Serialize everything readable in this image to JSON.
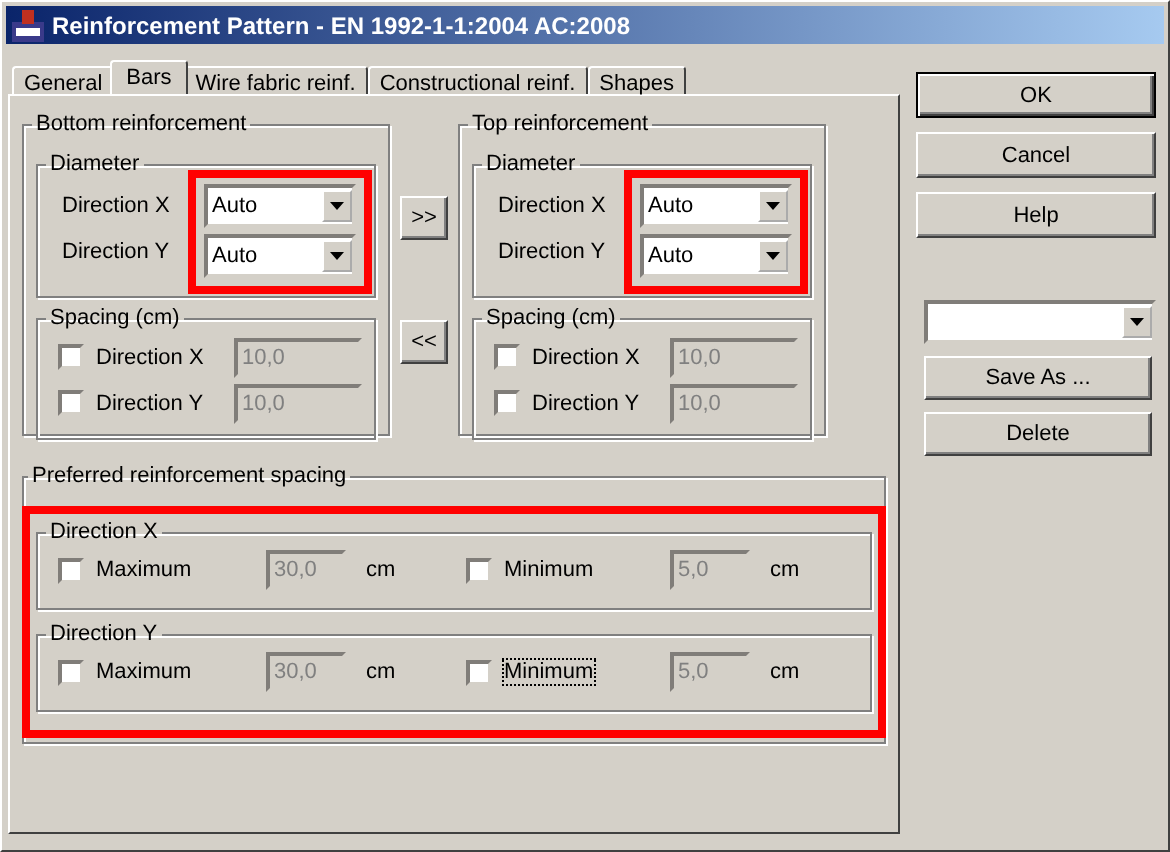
{
  "window": {
    "title": "Reinforcement Pattern - EN 1992-1-1:2004 AC:2008"
  },
  "tabs": [
    {
      "label": "General",
      "selected": false
    },
    {
      "label": "Bars",
      "selected": true
    },
    {
      "label": "Wire fabric reinf.",
      "selected": false
    },
    {
      "label": "Constructional reinf.",
      "selected": false
    },
    {
      "label": "Shapes",
      "selected": false
    }
  ],
  "bottom": {
    "title": "Bottom reinforcement",
    "diameter": {
      "title": "Diameter",
      "highlighted": true,
      "rows": [
        {
          "label": "Direction X",
          "value": "Auto"
        },
        {
          "label": "Direction Y",
          "value": "Auto"
        }
      ]
    },
    "spacing": {
      "title": "Spacing (cm)",
      "rows": [
        {
          "label": "Direction X",
          "checked": false,
          "value": "10,0",
          "disabled": true
        },
        {
          "label": "Direction Y",
          "checked": false,
          "value": "10,0",
          "disabled": true
        }
      ]
    }
  },
  "copy_buttons": [
    ">>",
    "<<"
  ],
  "top": {
    "title": "Top reinforcement",
    "diameter": {
      "title": "Diameter",
      "highlighted": true,
      "rows": [
        {
          "label": "Direction X",
          "value": "Auto"
        },
        {
          "label": "Direction Y",
          "value": "Auto"
        }
      ]
    },
    "spacing": {
      "title": "Spacing (cm)",
      "rows": [
        {
          "label": "Direction X",
          "checked": false,
          "value": "10,0",
          "disabled": true
        },
        {
          "label": "Direction Y",
          "checked": false,
          "value": "10,0",
          "disabled": true
        }
      ]
    }
  },
  "preferred": {
    "title": "Preferred reinforcement spacing",
    "highlighted": true,
    "groups": [
      {
        "title": "Direction X",
        "items": [
          {
            "label": "Maximum",
            "checked": false,
            "focused": false,
            "value": "30,0",
            "disabled": true,
            "unit": "cm"
          },
          {
            "label": "Minimum",
            "checked": false,
            "focused": false,
            "value": "5,0",
            "disabled": true,
            "unit": "cm"
          }
        ]
      },
      {
        "title": "Direction Y",
        "items": [
          {
            "label": "Maximum",
            "checked": false,
            "focused": false,
            "value": "30,0",
            "disabled": true,
            "unit": "cm"
          },
          {
            "label": "Minimum",
            "checked": false,
            "focused": true,
            "value": "5,0",
            "disabled": true,
            "unit": "cm"
          }
        ]
      }
    ]
  },
  "buttons": [
    {
      "label": "OK",
      "default": true
    },
    {
      "label": "Cancel",
      "default": false
    },
    {
      "label": "Help",
      "default": false
    }
  ],
  "preset_buttons": [
    "Save As ...",
    "Delete"
  ]
}
